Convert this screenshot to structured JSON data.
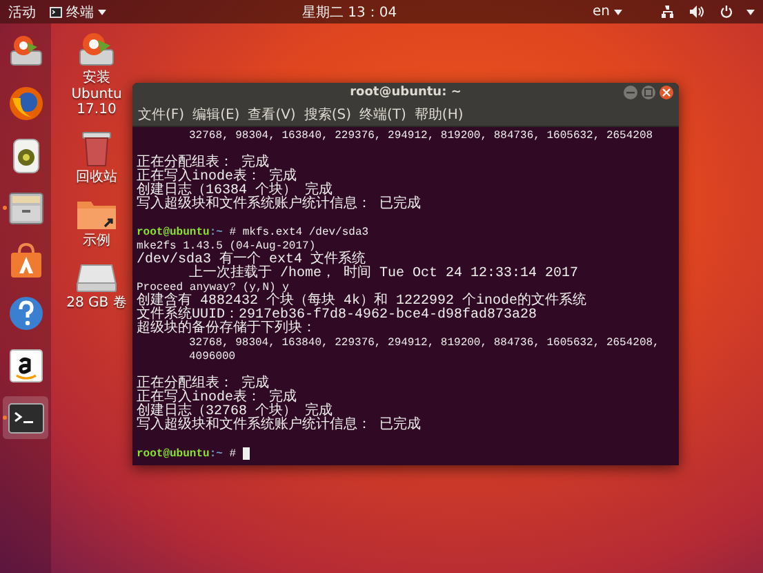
{
  "top_bar": {
    "activities": "活动",
    "app_menu": "终端",
    "clock": "星期二 13：04",
    "keyboard": "en"
  },
  "dock": [
    {
      "kind": "installer",
      "selected": false,
      "running": false
    },
    {
      "kind": "browser",
      "selected": false,
      "running": false
    },
    {
      "kind": "music",
      "selected": false,
      "running": false
    },
    {
      "kind": "files",
      "selected": false,
      "running": true
    },
    {
      "kind": "store",
      "selected": false,
      "running": false
    },
    {
      "kind": "help",
      "selected": false,
      "running": false
    },
    {
      "kind": "amazon",
      "selected": false,
      "running": false
    },
    {
      "kind": "terminal",
      "selected": true,
      "running": true
    }
  ],
  "desktop_icons": [
    {
      "kind": "installer",
      "label": "安装 Ubuntu 17.10"
    },
    {
      "kind": "trash",
      "label": "回收站"
    },
    {
      "kind": "folder",
      "label": "示例"
    },
    {
      "kind": "drive",
      "label": "28 GB 卷"
    }
  ],
  "terminal": {
    "title": "root@ubuntu: ~",
    "menu": [
      "文件(F)",
      "编辑(E)",
      "查看(V)",
      "搜索(S)",
      "终端(T)",
      "帮助(H)"
    ],
    "lines": [
      {
        "kind": "indented",
        "text": "32768, 98304, 163840, 229376, 294912, 819200, 884736, 1605632, 2654208"
      },
      {
        "kind": "blank"
      },
      {
        "kind": "plain",
        "text": "正在分配组表： 完成"
      },
      {
        "kind": "plain",
        "text": "正在写入inode表： 完成"
      },
      {
        "kind": "plain",
        "text": "创建日志（16384 个块） 完成"
      },
      {
        "kind": "plain",
        "text": "写入超级块和文件系统账户统计信息： 已完成"
      },
      {
        "kind": "blank"
      },
      {
        "kind": "prompt",
        "host": "root@ubuntu",
        "path": ":~",
        "command": "# mkfs.ext4 /dev/sda3",
        "cursor": false
      },
      {
        "kind": "plain",
        "text": "mke2fs 1.43.5 (04-Aug-2017)"
      },
      {
        "kind": "plain",
        "text": "/dev/sda3 有一个 ext4 文件系统"
      },
      {
        "kind": "indented",
        "text": "上一次挂载于 /home， 时间 Tue Oct 24 12:33:14 2017"
      },
      {
        "kind": "plain",
        "text": "Proceed anyway? (y,N) y"
      },
      {
        "kind": "plain",
        "text": "创建含有 4882432 个块（每块 4k）和 1222992 个inode的文件系统"
      },
      {
        "kind": "plain",
        "text": "文件系统UUID：2917eb36-f7d8-4962-bce4-d98fad873a28"
      },
      {
        "kind": "plain",
        "text": "超级块的备份存储于下列块："
      },
      {
        "kind": "indented",
        "text": "32768, 98304, 163840, 229376, 294912, 819200, 884736, 1605632, 2654208,"
      },
      {
        "kind": "indented",
        "text": "4096000"
      },
      {
        "kind": "blank"
      },
      {
        "kind": "plain",
        "text": "正在分配组表： 完成"
      },
      {
        "kind": "plain",
        "text": "正在写入inode表： 完成"
      },
      {
        "kind": "plain",
        "text": "创建日志（32768 个块） 完成"
      },
      {
        "kind": "plain",
        "text": "写入超级块和文件系统账户统计信息： 已完成"
      },
      {
        "kind": "blank"
      },
      {
        "kind": "prompt",
        "host": "root@ubuntu",
        "path": ":~",
        "command": "#",
        "cursor": true
      }
    ]
  }
}
